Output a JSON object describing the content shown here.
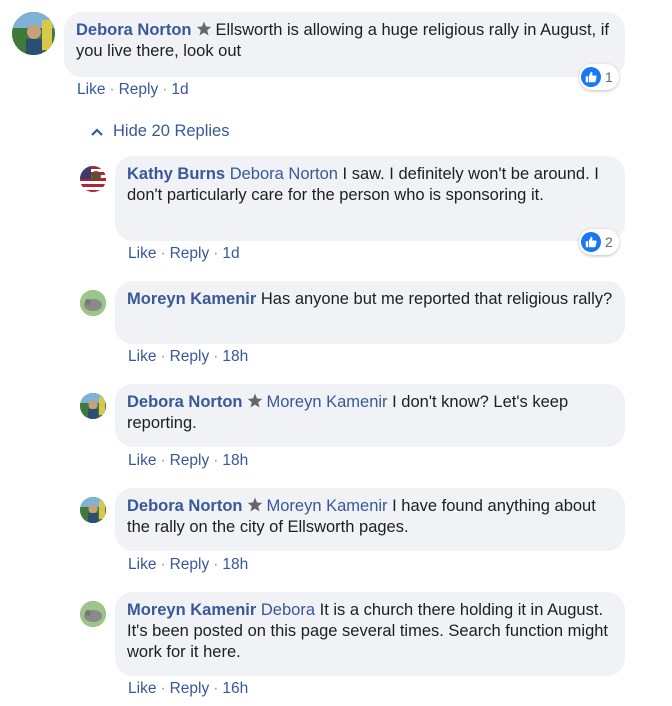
{
  "main_comment": {
    "author": "Debora Norton",
    "text": "Ellsworth is allowing a huge religious rally in August, if you live there, look out",
    "actions": {
      "like": "Like",
      "reply": "Reply",
      "time": "1d"
    },
    "reaction_count": "1"
  },
  "hide_replies_label": "Hide 20 Replies",
  "replies": [
    {
      "author": "Kathy Burns",
      "mention": "Debora Norton",
      "text": "I saw. I definitely won't be around. I don't particularly care for the person who is sponsoring it.",
      "actions": {
        "like": "Like",
        "reply": "Reply",
        "time": "1d"
      },
      "reaction_count": "2"
    },
    {
      "author": "Moreyn Kamenir",
      "mention": "",
      "text": "Has anyone but me reported that religious rally?",
      "actions": {
        "like": "Like",
        "reply": "Reply",
        "time": "18h"
      }
    },
    {
      "author": "Debora Norton",
      "mention": "Moreyn Kamenir",
      "text": "I don't know? Let's keep reporting.",
      "actions": {
        "like": "Like",
        "reply": "Reply",
        "time": "18h"
      }
    },
    {
      "author": "Debora Norton",
      "mention": "Moreyn Kamenir",
      "text": "I have found anything about the rally on the city of Ellsworth pages.",
      "actions": {
        "like": "Like",
        "reply": "Reply",
        "time": "18h"
      }
    },
    {
      "author": "Moreyn Kamenir",
      "mention": "Debora",
      "text": "It is a church there holding it in August. It's been posted on this page several times. Search function might work for it here.",
      "actions": {
        "like": "Like",
        "reply": "Reply",
        "time": "16h"
      }
    }
  ],
  "colors": {
    "link": "#385898",
    "bubble": "#f0f2f5",
    "like_blue": "#1877f2"
  }
}
